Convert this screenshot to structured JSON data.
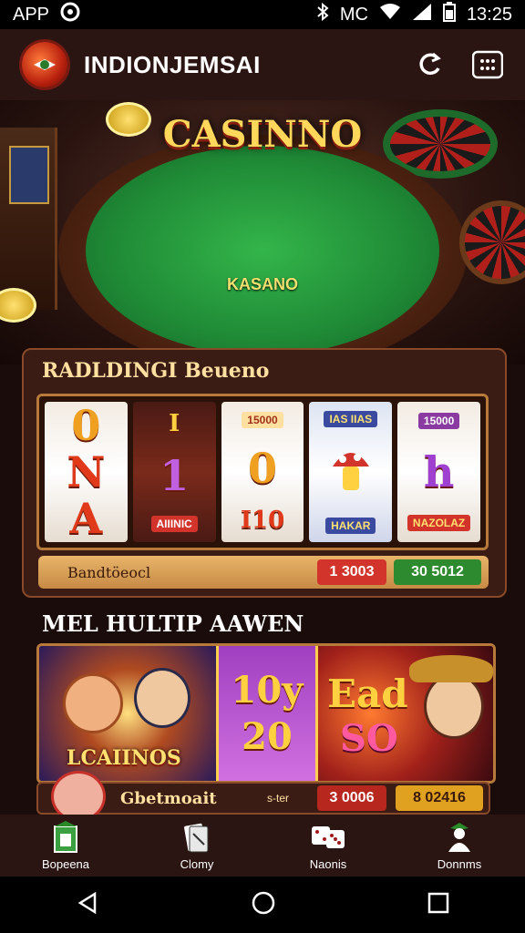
{
  "status_bar": {
    "left_label": "APP",
    "time": "13:25",
    "carrier": "MC"
  },
  "app_bar": {
    "title": "INDIONJEMSAI"
  },
  "hero": {
    "title": "CASINNO",
    "subtitle": "KASANO"
  },
  "section1": {
    "title": "RADLDINGI Beueno",
    "reels": [
      {
        "top": "0",
        "middle": "N",
        "bottom": "A"
      },
      {
        "top": "I",
        "middle": "1",
        "bottom": "AIIINIC"
      },
      {
        "top": "15000",
        "middle": "0",
        "bottom": "I10"
      },
      {
        "top": "IAS IIAS",
        "middle": "",
        "bottom": "HAKAR"
      },
      {
        "top": "15000",
        "middle": "h",
        "bottom": "NAZOLAZ"
      }
    ],
    "info_label": "Bandtöeocl",
    "red_value": "1 3003",
    "green_value": "30 5012"
  },
  "section2": {
    "title": "MEL HULTIP AAWEN",
    "promo_left_label": "LCAIINOS",
    "promo_mid_top": "10y",
    "promo_mid_bottom": "20",
    "promo_right_top": "Ead",
    "promo_right_bottom": "SO",
    "bar_label": "Gbetmoait",
    "bar_mid": "s-ter",
    "bar_red": "3 0006",
    "bar_gold": "8 02416"
  },
  "bottom_nav": [
    {
      "label": "Bopeena",
      "icon": "building-icon"
    },
    {
      "label": "Clomy",
      "icon": "cards-icon"
    },
    {
      "label": "Naonis",
      "icon": "dice-icon"
    },
    {
      "label": "Donnms",
      "icon": "person-icon"
    }
  ]
}
